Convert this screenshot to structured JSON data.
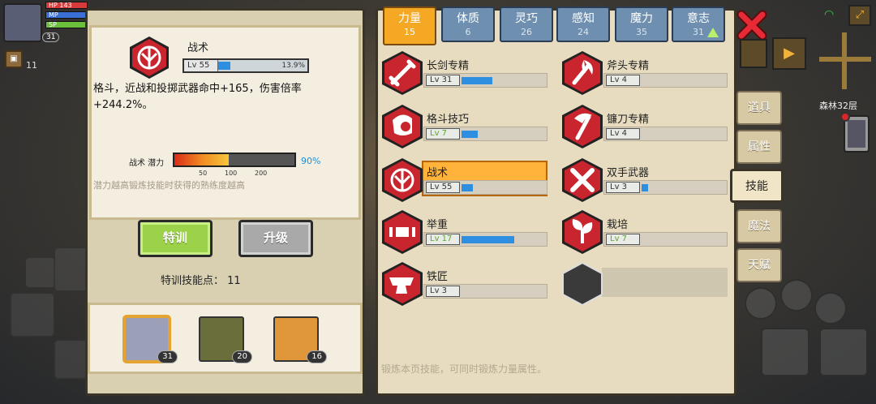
{
  "hud": {
    "bars": [
      {
        "label": "HP",
        "value": "143",
        "color": "#d63a3a"
      },
      {
        "label": "MP",
        "value": "",
        "color": "#3a6fd6"
      },
      {
        "label": "SP",
        "value": "",
        "color": "#6bbf3a"
      }
    ],
    "level": "31",
    "bag_count": "11"
  },
  "detail": {
    "skill_name": "战术",
    "level_label": "Lv 55",
    "progress_text": "13.9%",
    "progress": 0.139,
    "description": "格斗，近战和投掷武器命中+165，伤害倍率+244.2%。",
    "potential_label": "战术 潜力",
    "potential_text": "90%",
    "potential": 0.45,
    "ticks": [
      "50",
      "100",
      "200"
    ],
    "hint": "潜力越高锻炼技能时获得的熟练度越高"
  },
  "buttons": {
    "train": "特训",
    "upgrade": "升级"
  },
  "points": "特训技能点： 11",
  "party": [
    {
      "level": "31",
      "color": "#9b9fb8",
      "selected": true
    },
    {
      "level": "20",
      "color": "#6a6e3a",
      "selected": false
    },
    {
      "level": "16",
      "color": "#e0973a",
      "selected": false
    }
  ],
  "tabs": [
    {
      "label": "力量",
      "value": "15",
      "active": true
    },
    {
      "label": "体质",
      "value": "6"
    },
    {
      "label": "灵巧",
      "value": "26"
    },
    {
      "label": "感知",
      "value": "24"
    },
    {
      "label": "魔力",
      "value": "35"
    },
    {
      "label": "意志",
      "value": "31",
      "upgrade": true
    }
  ],
  "skills": [
    {
      "name": "长剑专精",
      "level": "Lv 31",
      "progress": 0.38,
      "icon": "sword",
      "level_green": false
    },
    {
      "name": "斧头专精",
      "level": "Lv 4",
      "progress": 0.0,
      "icon": "axe",
      "level_green": false
    },
    {
      "name": "格斗技巧",
      "level": "Lv 7",
      "progress": 0.2,
      "icon": "fist",
      "level_green": true
    },
    {
      "name": "镰刀专精",
      "level": "Lv 4",
      "progress": 0.0,
      "icon": "scythe",
      "level_green": false
    },
    {
      "name": "战术",
      "level": "Lv 55",
      "progress": 0.14,
      "icon": "tactics",
      "level_green": false,
      "selected": true
    },
    {
      "name": "双手武器",
      "level": "Lv 3",
      "progress": 0.08,
      "icon": "twohand",
      "level_green": false
    },
    {
      "name": "举重",
      "level": "Lv 17",
      "progress": 0.65,
      "icon": "weight",
      "level_green": true
    },
    {
      "name": "栽培",
      "level": "Lv 7",
      "progress": 0.0,
      "icon": "plant",
      "level_green": true
    },
    {
      "name": "铁匠",
      "level": "Lv 3",
      "progress": 0.0,
      "icon": "anvil",
      "level_green": false
    },
    {
      "empty": true
    }
  ],
  "footer_hint": "锻炼本页技能，可同时锻炼力量属性。",
  "side_menu": [
    "道具",
    "属性",
    "技能",
    "魔法",
    "天赋"
  ],
  "side_active": "技能",
  "floor": "森林32层",
  "colors": {
    "accent": "#f4a824",
    "hex_red": "#c8252e",
    "progress": "#2e8fe0"
  }
}
